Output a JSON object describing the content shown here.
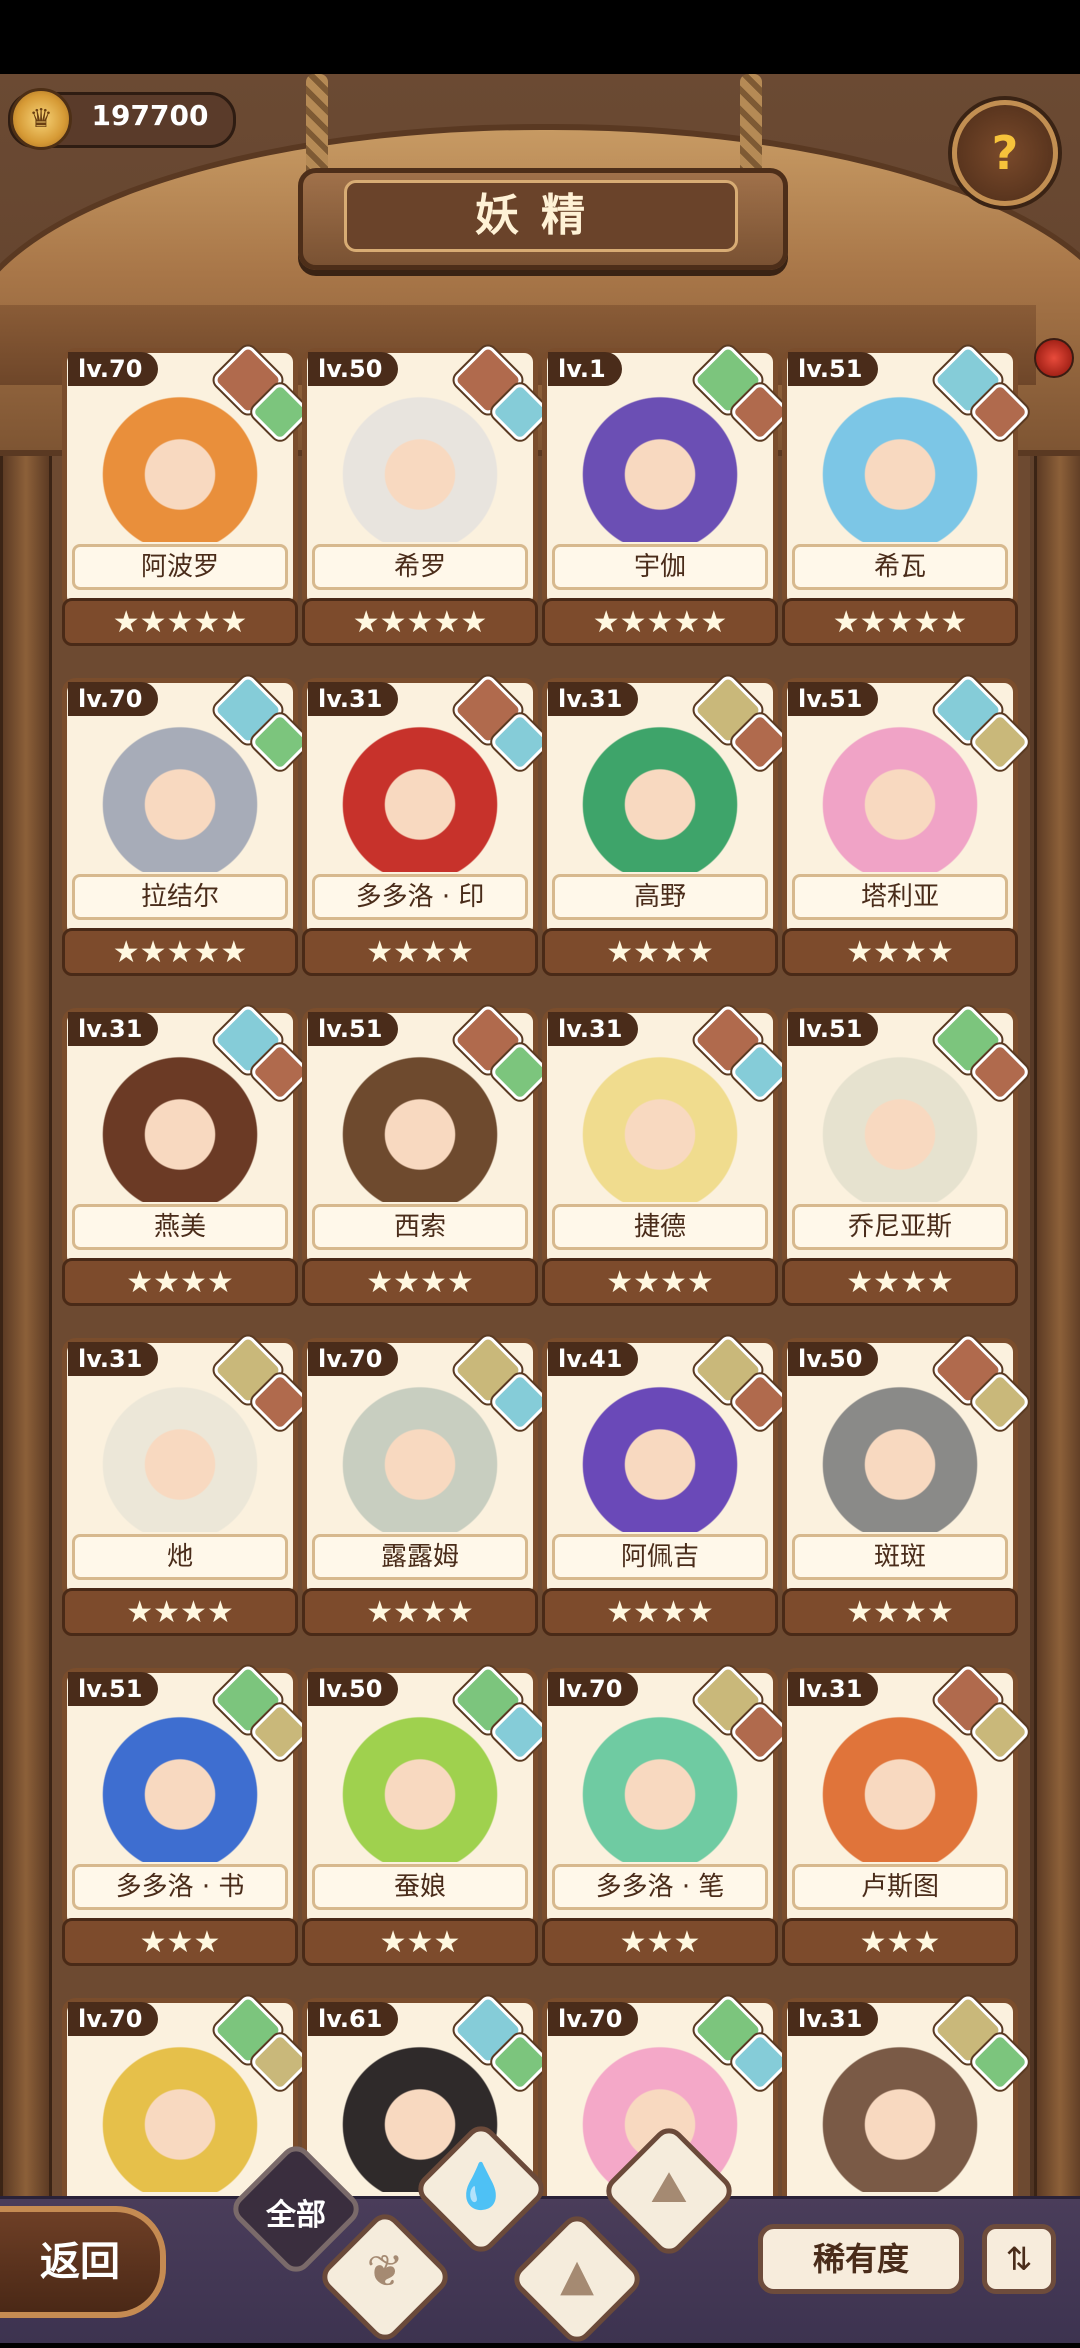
{
  "header": {
    "coins": "197700",
    "title": "妖精",
    "help_icon": "question-mark-icon"
  },
  "colors": {
    "fire": "#b06a4d",
    "leaf": "#7cc57d",
    "water": "#85ccd8",
    "earth": "#c9b87a"
  },
  "fairies": [
    {
      "level": "lv.70",
      "name": "阿波罗",
      "stars": "★★★★★",
      "elements": [
        "fire",
        "leaf"
      ],
      "art_color": "#e98f3b"
    },
    {
      "level": "lv.50",
      "name": "希罗",
      "stars": "★★★★★",
      "elements": [
        "fire",
        "water"
      ],
      "art_color": "#e8e4de"
    },
    {
      "level": "lv.1",
      "name": "宇伽",
      "stars": "★★★★★",
      "elements": [
        "leaf",
        "fire"
      ],
      "art_color": "#6b4fb4"
    },
    {
      "level": "lv.51",
      "name": "希瓦",
      "stars": "★★★★★",
      "elements": [
        "water",
        "fire"
      ],
      "art_color": "#7cc6e6"
    },
    {
      "level": "lv.70",
      "name": "拉结尔",
      "stars": "★★★★★",
      "elements": [
        "water",
        "leaf"
      ],
      "art_color": "#a7acb8"
    },
    {
      "level": "lv.31",
      "name": "多多洛 · 印",
      "stars": "★★★★",
      "elements": [
        "fire",
        "water"
      ],
      "art_color": "#c7322b"
    },
    {
      "level": "lv.31",
      "name": "高野",
      "stars": "★★★★",
      "elements": [
        "earth",
        "fire"
      ],
      "art_color": "#3ea46a"
    },
    {
      "level": "lv.51",
      "name": "塔利亚",
      "stars": "★★★★",
      "elements": [
        "water",
        "earth"
      ],
      "art_color": "#f0a3c6"
    },
    {
      "level": "lv.31",
      "name": "燕美",
      "stars": "★★★★",
      "elements": [
        "water",
        "fire"
      ],
      "art_color": "#6b3a25"
    },
    {
      "level": "lv.51",
      "name": "西索",
      "stars": "★★★★",
      "elements": [
        "fire",
        "leaf"
      ],
      "art_color": "#6e4a2e"
    },
    {
      "level": "lv.31",
      "name": "捷德",
      "stars": "★★★★",
      "elements": [
        "fire",
        "water"
      ],
      "art_color": "#f0dc8e"
    },
    {
      "level": "lv.51",
      "name": "乔尼亚斯",
      "stars": "★★★★",
      "elements": [
        "leaf",
        "fire"
      ],
      "art_color": "#e6e2cf"
    },
    {
      "level": "lv.31",
      "name": "灺",
      "stars": "★★★★",
      "elements": [
        "earth",
        "fire"
      ],
      "art_color": "#ece7d8"
    },
    {
      "level": "lv.70",
      "name": "露露姆",
      "stars": "★★★★",
      "elements": [
        "earth",
        "water"
      ],
      "art_color": "#c8cec0"
    },
    {
      "level": "lv.41",
      "name": "阿佩吉",
      "stars": "★★★★",
      "elements": [
        "earth",
        "fire"
      ],
      "art_color": "#6a49b8"
    },
    {
      "level": "lv.50",
      "name": "斑斑",
      "stars": "★★★★",
      "elements": [
        "fire",
        "earth"
      ],
      "art_color": "#8a8a88"
    },
    {
      "level": "lv.51",
      "name": "多多洛 · 书",
      "stars": "★★★",
      "elements": [
        "leaf",
        "earth"
      ],
      "art_color": "#3e6ed0"
    },
    {
      "level": "lv.50",
      "name": "蚕娘",
      "stars": "★★★",
      "elements": [
        "leaf",
        "water"
      ],
      "art_color": "#9fd14e"
    },
    {
      "level": "lv.70",
      "name": "多多洛 · 笔",
      "stars": "★★★",
      "elements": [
        "earth",
        "fire"
      ],
      "art_color": "#6fcba2"
    },
    {
      "level": "lv.31",
      "name": "卢斯图",
      "stars": "★★★",
      "elements": [
        "fire",
        "earth"
      ],
      "art_color": "#e0743a"
    },
    {
      "level": "lv.70",
      "name": "",
      "stars": "",
      "elements": [
        "leaf",
        "earth"
      ],
      "art_color": "#e6c04a"
    },
    {
      "level": "lv.61",
      "name": "",
      "stars": "",
      "elements": [
        "water",
        "leaf"
      ],
      "art_color": "#2f2a2a"
    },
    {
      "level": "lv.70",
      "name": "",
      "stars": "",
      "elements": [
        "leaf",
        "water"
      ],
      "art_color": "#f4a8c8"
    },
    {
      "level": "lv.31",
      "name": "",
      "stars": "",
      "elements": [
        "earth",
        "leaf"
      ],
      "art_color": "#7a5a46"
    }
  ],
  "bottom": {
    "back_label": "返回",
    "filter_all_label": "全部",
    "filter_icons": [
      "leaf-icon",
      "water-drop-icon",
      "mountain-icon",
      "volcano-icon"
    ],
    "sort_label": "稀有度",
    "order_icon": "sort-order-icon"
  }
}
